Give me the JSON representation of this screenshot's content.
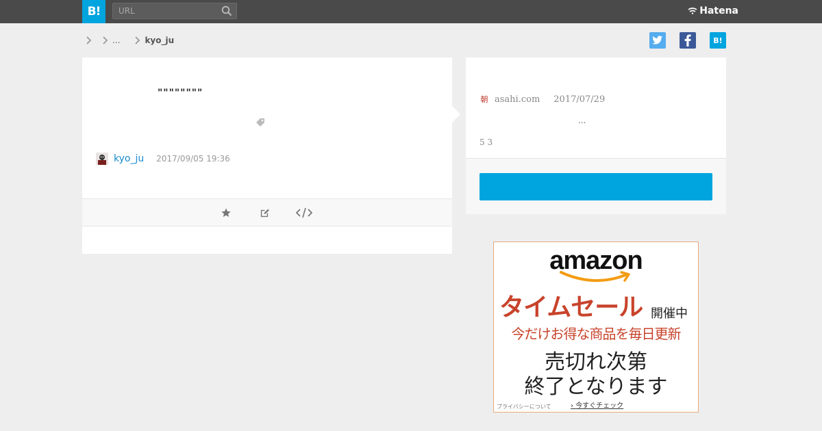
{
  "header": {
    "logo_text": "B!",
    "search_placeholder": "URL",
    "brand": "Hatena"
  },
  "breadcrumb": {
    "ellipsis": "...",
    "current": "kyo_ju"
  },
  "share": {
    "hatena_label": "B!"
  },
  "bookmark": {
    "comment": "\"\"\"\"\"\"\"\"",
    "user": "kyo_ju",
    "timestamp": "2017/09/05 19:36"
  },
  "entry": {
    "source": "asahi.com",
    "date": "2017/07/29",
    "snippet": "...",
    "counts": "5 3"
  },
  "ad": {
    "logo": "amazon",
    "headline": "タイムセール",
    "headline_suffix": "開催中",
    "subline": "今だけお得な商品を毎日更新",
    "line3": "売切れ次第",
    "line4": "終了となります",
    "privacy": "プライバシーについて",
    "cta": "今すぐチェック"
  },
  "colors": {
    "topbar": "#4a4a4a",
    "accent": "#00a4de",
    "link": "#1a8bd0",
    "twitter": "#55acee",
    "facebook": "#3b5998",
    "ad_red": "#c8432b"
  },
  "icons": [
    "search-icon",
    "hatena-logo-icon",
    "chevron-right-icon",
    "twitter-icon",
    "facebook-icon",
    "tag-icon",
    "star-icon",
    "edit-icon",
    "embed-code-icon"
  ]
}
